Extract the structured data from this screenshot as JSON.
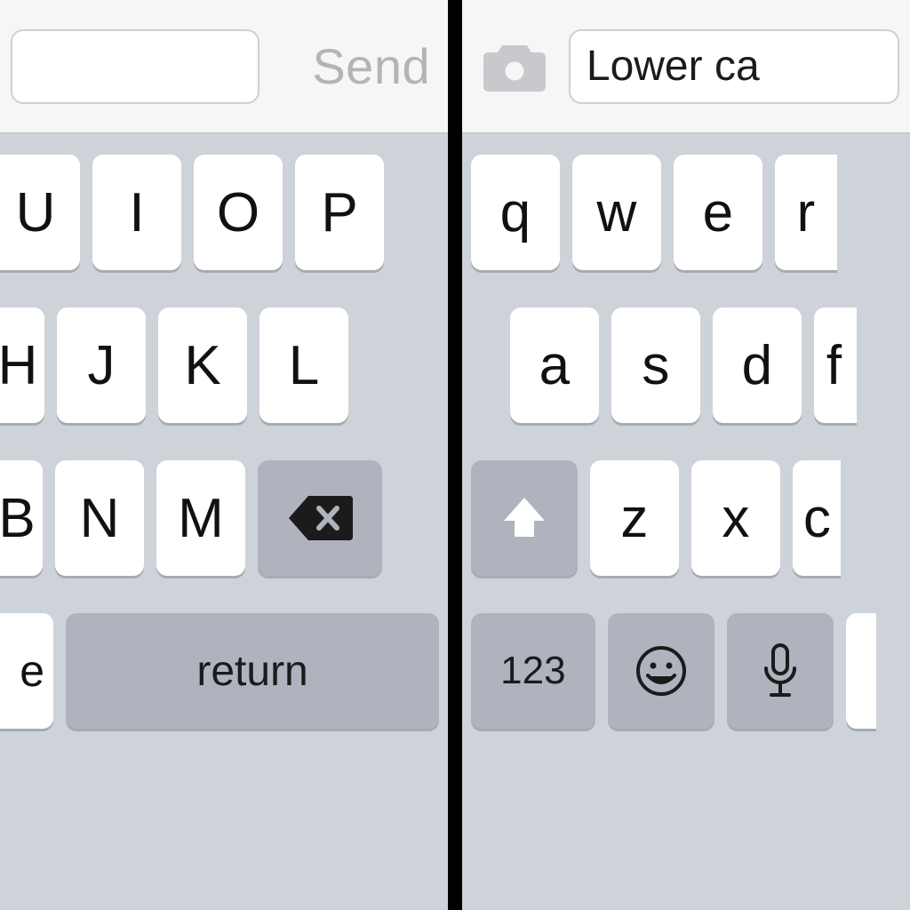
{
  "left": {
    "topbar": {
      "input_value": "",
      "send_label": "Send"
    },
    "keyboard": {
      "row1": [
        "U",
        "I",
        "O",
        "P"
      ],
      "row2": [
        "H",
        "J",
        "K",
        "L"
      ],
      "row3_letters": [
        "B",
        "N",
        "M"
      ],
      "space_fragment_label": "e",
      "return_label": "return"
    }
  },
  "right": {
    "topbar": {
      "input_value": "Lower ca"
    },
    "keyboard": {
      "row1": [
        "q",
        "w",
        "e",
        "r"
      ],
      "row2": [
        "a",
        "s",
        "d",
        "f"
      ],
      "row3_letters": [
        "z",
        "x",
        "c"
      ],
      "numbers_label": "123"
    }
  },
  "icons": {
    "camera": "camera-icon",
    "backspace": "backspace-icon",
    "shift": "shift-icon",
    "emoji": "emoji-icon",
    "mic": "mic-icon"
  }
}
